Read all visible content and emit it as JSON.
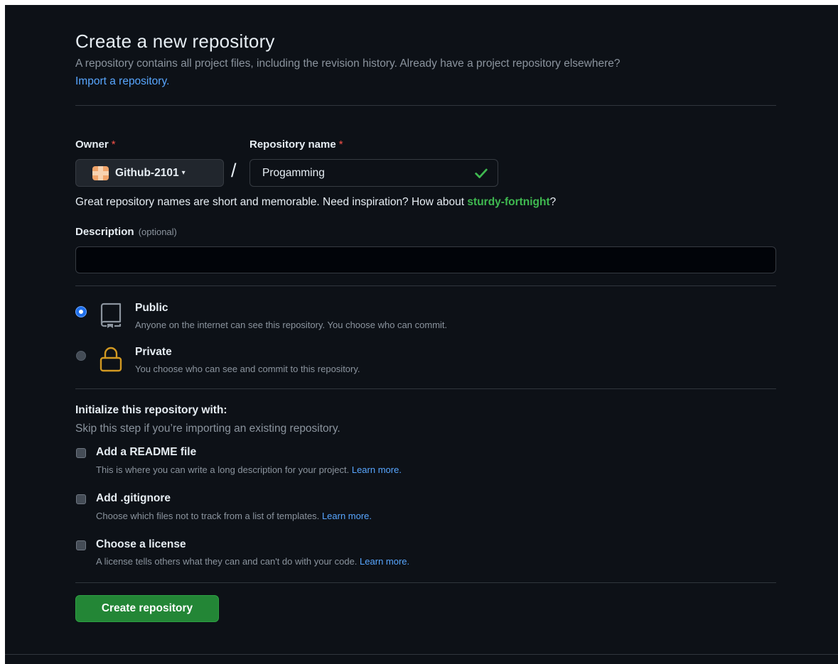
{
  "header": {
    "title": "Create a new repository",
    "subtitle": "A repository contains all project files, including the revision history. Already have a project repository elsewhere?",
    "import_link": "Import a repository."
  },
  "owner": {
    "label": "Owner",
    "required_mark": "*",
    "value": "Github-2101",
    "caret": "▾"
  },
  "repo_name": {
    "label": "Repository name",
    "required_mark": "*",
    "separator": "/",
    "value": "Progamming",
    "valid_icon": "check-icon"
  },
  "hint": {
    "text": "Great repository names are short and memorable. Need inspiration? How about ",
    "suggestion": "sturdy-fortnight",
    "suffix": "?"
  },
  "description": {
    "label": "Description",
    "optional": "(optional)",
    "value": ""
  },
  "visibility": {
    "selected": "public",
    "options": [
      {
        "title": "Public",
        "description": "Anyone on the internet can see this repository. You choose who can commit.",
        "icon": "repo-icon"
      },
      {
        "title": "Private",
        "description": "You choose who can see and commit to this repository.",
        "icon": "lock-icon"
      }
    ]
  },
  "initialize": {
    "title": "Initialize this repository with:",
    "subtitle": "Skip this step if you’re importing an existing repository.",
    "options": [
      {
        "title": "Add a README file",
        "description": "This is where you can write a long description for your project.",
        "link": "Learn more.",
        "checked": false
      },
      {
        "title": "Add .gitignore",
        "description": "Choose which files not to track from a list of templates.",
        "link": "Learn more.",
        "checked": false
      },
      {
        "title": "Choose a license",
        "description": "A license tells others what they can and can't do with your code.",
        "link": "Learn more.",
        "checked": false
      }
    ]
  },
  "submit": {
    "label": "Create repository"
  },
  "colors": {
    "background": "#0d1117",
    "link": "#58a6ff",
    "success": "#3fb950",
    "primary_button": "#238636",
    "lock_icon": "#d29922",
    "required": "#f85149"
  }
}
